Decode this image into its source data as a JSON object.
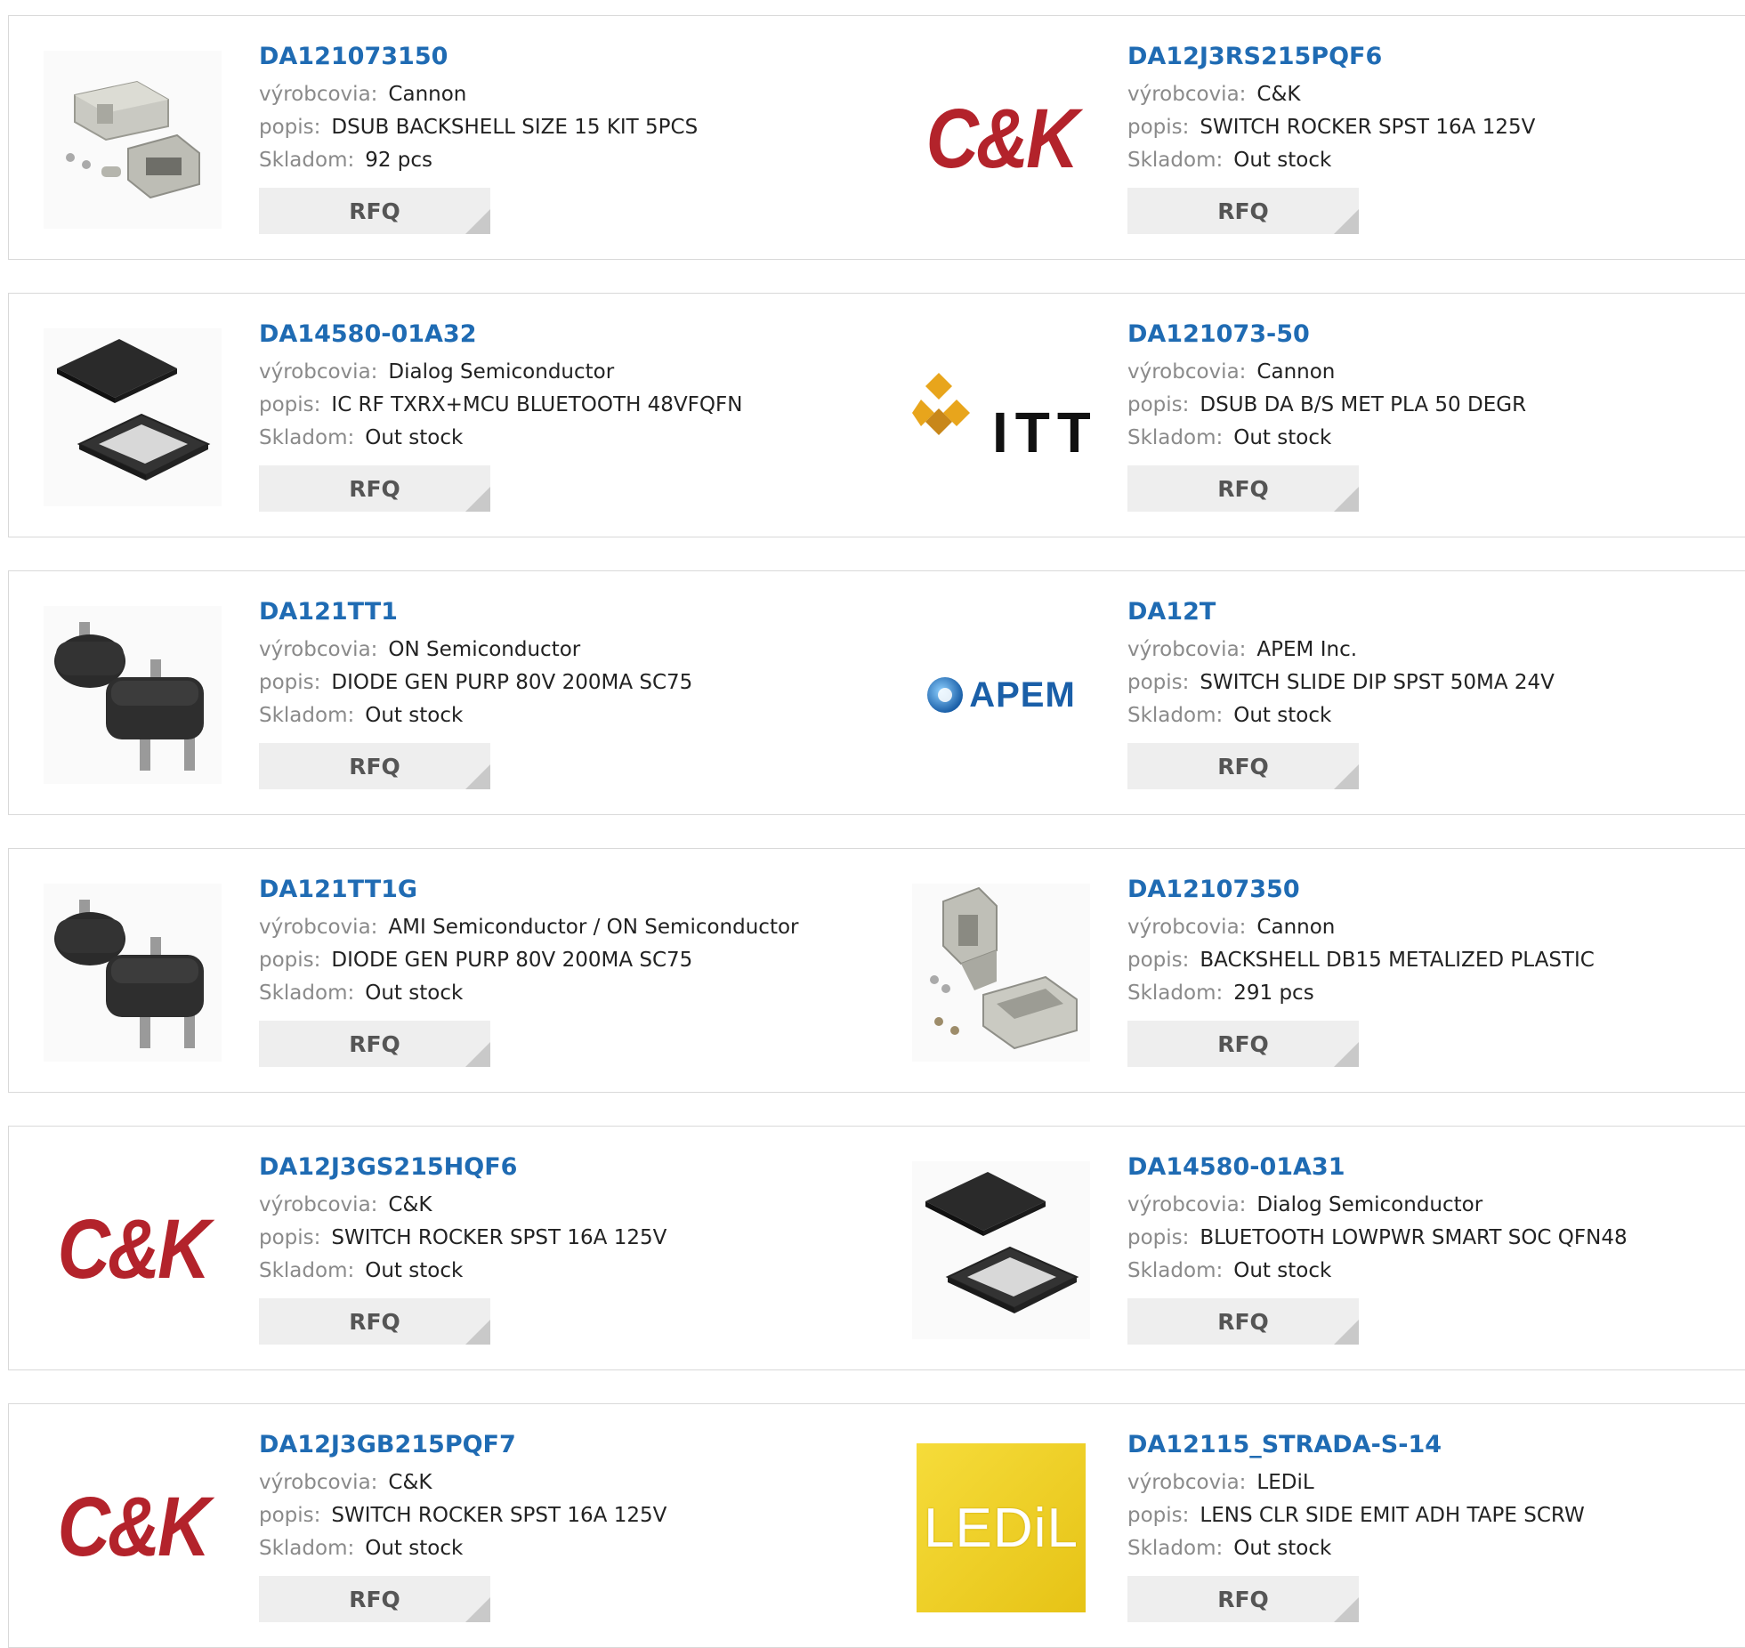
{
  "labels": {
    "manufacturer": "výrobcovia:",
    "description": "popis:",
    "stock": "Skladom:",
    "rfq": "RFQ"
  },
  "products": [
    {
      "part": "DA121073150",
      "manufacturer": "Cannon",
      "description": "DSUB BACKSHELL SIZE 15 KIT 5PCS",
      "stock": "92 pcs",
      "image": "dsub-backshell-kit-photo"
    },
    {
      "part": "DA12J3RS215PQF6",
      "manufacturer": "C&K",
      "description": "SWITCH ROCKER SPST 16A 125V",
      "stock": "Out stock",
      "image": "ck-logo"
    },
    {
      "part": "DA14580-01A32",
      "manufacturer": "Dialog Semiconductor",
      "description": "IC RF TXRX+MCU BLUETOOTH 48VFQFN",
      "stock": "Out stock",
      "image": "qfn-chip-photo"
    },
    {
      "part": "DA121073-50",
      "manufacturer": "Cannon",
      "description": "DSUB DA B/S MET PLA 50 DEGR",
      "stock": "Out stock",
      "image": "itt-logo"
    },
    {
      "part": "DA121TT1",
      "manufacturer": "ON Semiconductor",
      "description": "DIODE GEN PURP 80V 200MA SC75",
      "stock": "Out stock",
      "image": "sot-package-photo"
    },
    {
      "part": "DA12T",
      "manufacturer": "APEM Inc.",
      "description": "SWITCH SLIDE DIP SPST 50MA 24V",
      "stock": "Out stock",
      "image": "apem-logo"
    },
    {
      "part": "DA121TT1G",
      "manufacturer": "AMI Semiconductor / ON Semiconductor",
      "description": "DIODE GEN PURP 80V 200MA SC75",
      "stock": "Out stock",
      "image": "sot-package-photo"
    },
    {
      "part": "DA12107350",
      "manufacturer": "Cannon",
      "description": "BACKSHELL DB15 METALIZED PLASTIC",
      "stock": "291 pcs",
      "image": "db15-backshell-photo"
    },
    {
      "part": "DA12J3GS215HQF6",
      "manufacturer": "C&K",
      "description": "SWITCH ROCKER SPST 16A 125V",
      "stock": "Out stock",
      "image": "ck-logo"
    },
    {
      "part": "DA14580-01A31",
      "manufacturer": "Dialog Semiconductor",
      "description": "BLUETOOTH LOWPWR SMART SOC QFN48",
      "stock": "Out stock",
      "image": "qfn-chip-photo"
    },
    {
      "part": "DA12J3GB215PQF7",
      "manufacturer": "C&K",
      "description": "SWITCH ROCKER SPST 16A 125V",
      "stock": "Out stock",
      "image": "ck-logo"
    },
    {
      "part": "DA12115_STRADA-S-14",
      "manufacturer": "LEDiL",
      "description": "LENS CLR SIDE EMIT ADH TAPE SCRW",
      "stock": "Out stock",
      "image": "ledil-logo"
    }
  ],
  "logos": {
    "ck": "C&K",
    "itt": "ITT",
    "apem": "APEM",
    "ledil": "LEDiL"
  },
  "colors": {
    "link": "#1f6bb3",
    "ck_red": "#b3232b",
    "apem_blue": "#1a5fa8",
    "ledil_yellow": "#f0cf1e"
  }
}
